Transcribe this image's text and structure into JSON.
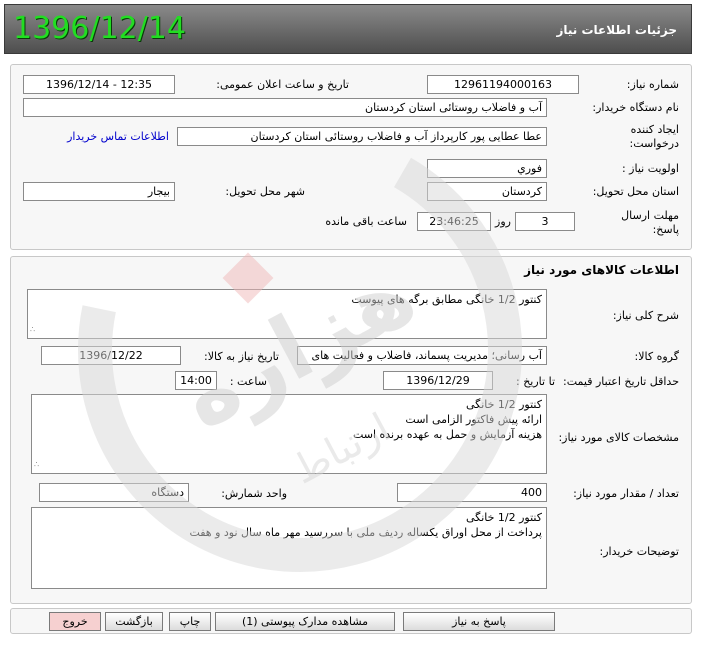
{
  "header": {
    "big_date": "1396/12/14",
    "title": "جزئیات اطلاعات نیاز"
  },
  "info": {
    "need_number_label": "شماره نیاز:",
    "need_number": "12961194000163",
    "announce_label": "تاریخ و ساعت اعلان عمومی:",
    "announce_value": "1396/12/14 - 12:35",
    "buyer_org_label": "نام دستگاه خریدار:",
    "buyer_org": "آب و فاضلاب روستائی استان کردستان",
    "creator_label": "ایجاد کننده درخواست:",
    "creator": "عطا عطایی پور کارپرداز آب و فاضلاب روستائی استان کردستان",
    "contact_link": "اطلاعات تماس خریدار",
    "priority_label": "اولویت نیاز :",
    "priority": "فوري",
    "province_label": "استان محل تحویل:",
    "province": "کردستان",
    "city_label": "شهر محل تحویل:",
    "city": "بیجار",
    "deadline_label": "مهلت ارسال پاسخ:",
    "deadline_days": "3",
    "days_and": "روز و",
    "deadline_time": "23:46:25",
    "remaining": "ساعت باقی مانده"
  },
  "goods": {
    "section_title": "اطلاعات کالاهای مورد نیاز",
    "general_desc_label": "شرح کلی نیاز:",
    "general_desc": "کنتور 1/2 خانگی مطابق برگه های پیوست",
    "group_label": "گروه کالا:",
    "group": "آب رسانی؛ مدیریت پسماند، فاضلاب و فعالیت های",
    "need_date_label": "تاریخ نیاز به کالا:",
    "need_date": "1396/12/22",
    "validity_label": "حداقل تاریخ اعتبار قیمت:",
    "to_date_label": "تا تاریخ :",
    "validity_date": "1396/12/29",
    "time_label": "ساعت :",
    "validity_time": "14:00",
    "specs_label": "مشخصات کالای مورد نیاز:",
    "specs": "کنتور 1/2 خانگی\nارائه پیش فاکتور الزامی است\nهزینه آزمایش و حمل به عهده برنده است",
    "qty_label": "تعداد / مقدار مورد نیاز:",
    "qty": "400",
    "unit_label": "واحد شمارش:",
    "unit": "دستگاه",
    "buyer_notes_label": "توضیحات خریدار:",
    "buyer_notes": "کنتور 1/2 خانگی\nپرداخت از محل اوراق یکساله ردیف ملی با سررسید مهر ماه سال نود و هفت"
  },
  "buttons": {
    "reply": "پاسخ به نیاز",
    "view_docs": "مشاهده مدارک پیوستی (1)",
    "print": "چاپ",
    "back": "بازگشت",
    "exit": "خروج"
  },
  "watermark": {
    "text_main": "هزاره",
    "text_sub": "ارتباط"
  },
  "colors": {
    "big_date": "#22dd22",
    "link": "#0000cc",
    "exit_button": "#f6d0d0"
  }
}
